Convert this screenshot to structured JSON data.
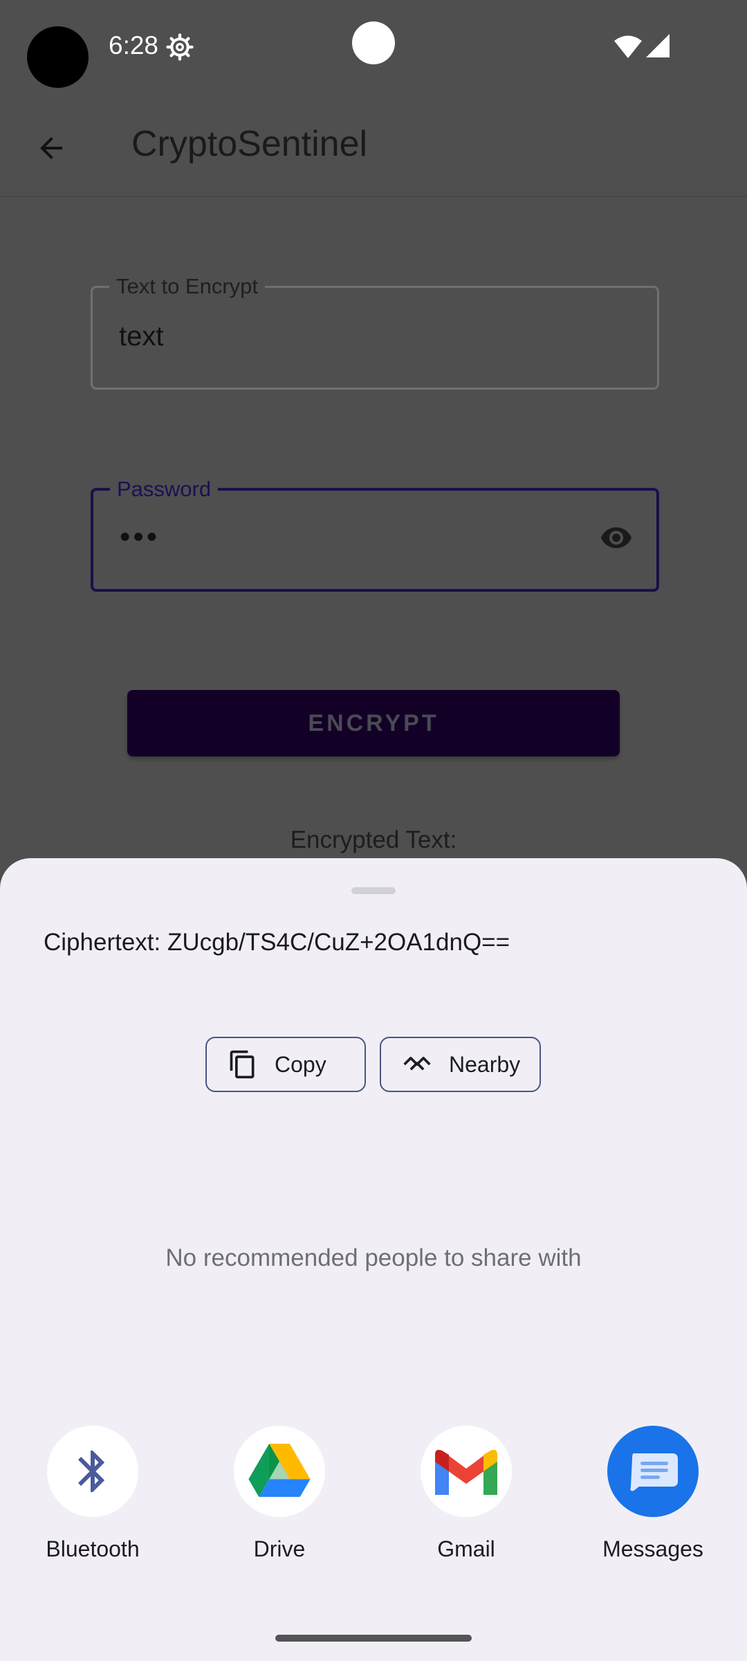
{
  "status_bar": {
    "time": "6:28"
  },
  "app_bar": {
    "title": "CryptoSentinel"
  },
  "form": {
    "text_field": {
      "label": "Text to Encrypt",
      "value": "text"
    },
    "password_field": {
      "label": "Password",
      "value": "•••"
    },
    "encrypt_button": "ENCRYPT",
    "encrypted_label": "Encrypted Text:"
  },
  "share_sheet": {
    "ciphertext": "Ciphertext: ZUcgb/TS4C/CuZ+2OA1dnQ==",
    "actions": [
      {
        "label": "Copy",
        "icon": "copy-icon"
      },
      {
        "label": "Nearby",
        "icon": "nearby-icon"
      }
    ],
    "no_people_text": "No recommended people to share with",
    "targets": [
      {
        "label": "Bluetooth",
        "icon": "bluetooth-icon"
      },
      {
        "label": "Drive",
        "icon": "drive-icon"
      },
      {
        "label": "Gmail",
        "icon": "gmail-icon"
      },
      {
        "label": "Messages",
        "icon": "messages-icon"
      }
    ]
  },
  "colors": {
    "scrim": "#4f4f4f",
    "sheet_background": "#f1eff5",
    "accent": "#1b0f4a",
    "messages_blue": "#1a73e8"
  }
}
